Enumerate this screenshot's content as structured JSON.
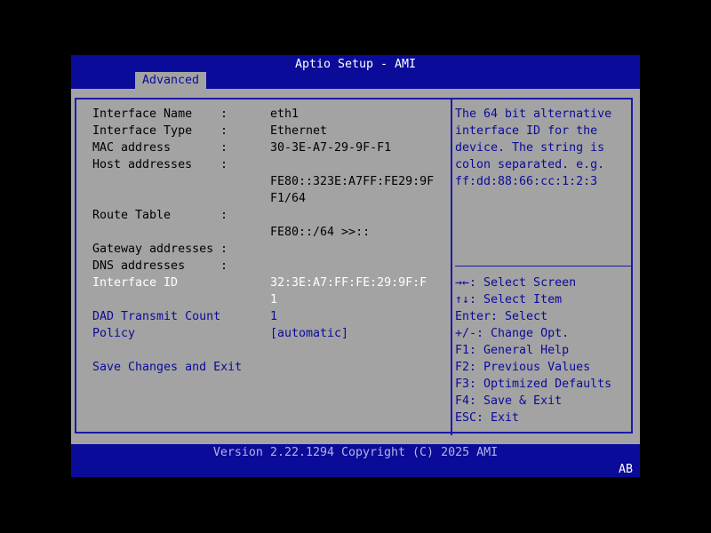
{
  "header": {
    "title": "Aptio Setup - AMI",
    "tab": "Advanced"
  },
  "rows": [
    {
      "label": "Interface Name",
      "colon": ":",
      "value": "eth1"
    },
    {
      "label": "Interface Type",
      "colon": ":",
      "value": "Ethernet"
    },
    {
      "label": "MAC address",
      "colon": ":",
      "value": "30-3E-A7-29-9F-F1"
    },
    {
      "label": "Host addresses",
      "colon": ":",
      "value": ""
    },
    {
      "value": "FE80::323E:A7FF:FE29:9F"
    },
    {
      "value": "F1/64"
    },
    {
      "label": "Route Table",
      "colon": ":"
    },
    {
      "value": "FE80::/64 >>::"
    },
    {
      "label": "Gateway addresses",
      "colon": ":"
    },
    {
      "label": "DNS addresses",
      "colon": ":"
    },
    {
      "label": "Interface ID",
      "value": "32:3E:A7:FF:FE:29:9F:F"
    },
    {
      "value": "1"
    },
    {
      "label": "DAD Transmit Count",
      "value": "1"
    },
    {
      "label": "Policy",
      "value": "[automatic]"
    },
    {
      "label": "Save Changes and Exit"
    }
  ],
  "help": [
    "The 64 bit alternative",
    "interface ID for the",
    "device. The string is",
    "colon separated. e.g.",
    "ff:dd:88:66:cc:1:2:3"
  ],
  "keys": [
    "→←: Select Screen",
    "↑↓: Select Item",
    "Enter: Select",
    "+/-: Change Opt.",
    "F1: General Help",
    "F2: Previous Values",
    "F3: Optimized Defaults",
    "F4: Save & Exit",
    "ESC: Exit"
  ],
  "footer": {
    "version": "Version 2.22.1294 Copyright (C) 2025 AMI",
    "indicator": "AB"
  },
  "colors": {
    "blue": "#0b0b99",
    "gray": "#a3a3a3",
    "selected": "#ffffff"
  }
}
